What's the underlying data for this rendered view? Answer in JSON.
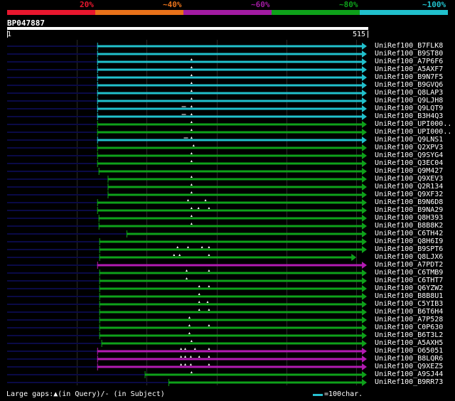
{
  "identity_legend": {
    "labels": [
      "20%",
      "~40%",
      "~60%",
      "~80%",
      "~100%"
    ],
    "colors": [
      "#e8172e",
      "#e8721a",
      "#a21ba2",
      "#0ea11a",
      "#21c0cc"
    ]
  },
  "query": {
    "name": "BP047887",
    "start": "1",
    "end": "515",
    "length": 515
  },
  "colors": {
    "cyan": "#21c0cc",
    "green": "#0ea11a",
    "magenta": "#b21bb2",
    "unaligned": "#0a0a46",
    "grid": "#2a2a2a",
    "gap_marker": "#ffffff"
  },
  "hits": [
    {
      "id": "UniRef100_B7FLK8",
      "color": "cyan",
      "start": 130,
      "end": 515,
      "query_gaps": [],
      "subject_gaps": []
    },
    {
      "id": "UniRef100_B9ST80",
      "color": "cyan",
      "start": 130,
      "end": 515,
      "query_gaps": [],
      "subject_gaps": []
    },
    {
      "id": "UniRef100_A7P6F6",
      "color": "cyan",
      "start": 130,
      "end": 515,
      "query_gaps": [
        265
      ],
      "subject_gaps": []
    },
    {
      "id": "UniRef100_A5AXF7",
      "color": "cyan",
      "start": 130,
      "end": 515,
      "query_gaps": [
        265
      ],
      "subject_gaps": []
    },
    {
      "id": "UniRef100_B9N7F5",
      "color": "cyan",
      "start": 130,
      "end": 515,
      "query_gaps": [
        265
      ],
      "subject_gaps": []
    },
    {
      "id": "UniRef100_B9GVQ6",
      "color": "cyan",
      "start": 130,
      "end": 515,
      "query_gaps": [
        265
      ],
      "subject_gaps": []
    },
    {
      "id": "UniRef100_Q8LAP3",
      "color": "cyan",
      "start": 130,
      "end": 515,
      "query_gaps": [
        265
      ],
      "subject_gaps": []
    },
    {
      "id": "UniRef100_Q9LJH8",
      "color": "cyan",
      "start": 130,
      "end": 515,
      "query_gaps": [
        265
      ],
      "subject_gaps": []
    },
    {
      "id": "UniRef100_Q9LQT9",
      "color": "cyan",
      "start": 130,
      "end": 515,
      "query_gaps": [
        265
      ],
      "subject_gaps": [
        254
      ]
    },
    {
      "id": "UniRef100_B3H4Q3",
      "color": "cyan",
      "start": 130,
      "end": 515,
      "query_gaps": [
        265
      ],
      "subject_gaps": [
        254
      ]
    },
    {
      "id": "UniRef100_UPI000..",
      "color": "green",
      "start": 130,
      "end": 515,
      "query_gaps": [
        265
      ],
      "subject_gaps": []
    },
    {
      "id": "UniRef100_UPI000..",
      "color": "green",
      "start": 130,
      "end": 515,
      "query_gaps": [
        265
      ],
      "subject_gaps": []
    },
    {
      "id": "UniRef100_Q9LNS1",
      "color": "cyan",
      "start": 130,
      "end": 515,
      "query_gaps": [
        265
      ],
      "subject_gaps": [
        257
      ]
    },
    {
      "id": "UniRef100_Q2XPV3",
      "color": "green",
      "start": 130,
      "end": 515,
      "query_gaps": [
        268
      ],
      "subject_gaps": []
    },
    {
      "id": "UniRef100_Q9SYG4",
      "color": "green",
      "start": 130,
      "end": 515,
      "query_gaps": [
        265
      ],
      "subject_gaps": []
    },
    {
      "id": "UniRef100_Q3EC04",
      "color": "green",
      "start": 130,
      "end": 515,
      "query_gaps": [
        265
      ],
      "subject_gaps": []
    },
    {
      "id": "UniRef100_Q9M427",
      "color": "green",
      "start": 132,
      "end": 515,
      "query_gaps": [],
      "subject_gaps": []
    },
    {
      "id": "UniRef100_Q9XEV3",
      "color": "green",
      "start": 145,
      "end": 515,
      "query_gaps": [
        265
      ],
      "subject_gaps": []
    },
    {
      "id": "UniRef100_Q2R134",
      "color": "green",
      "start": 145,
      "end": 515,
      "query_gaps": [
        265
      ],
      "subject_gaps": []
    },
    {
      "id": "UniRef100_Q9XF32",
      "color": "green",
      "start": 145,
      "end": 515,
      "query_gaps": [
        265
      ],
      "subject_gaps": []
    },
    {
      "id": "UniRef100_B9N6D8",
      "color": "green",
      "start": 130,
      "end": 515,
      "query_gaps": [
        260,
        285
      ],
      "subject_gaps": []
    },
    {
      "id": "UniRef100_B9NA29",
      "color": "green",
      "start": 130,
      "end": 515,
      "query_gaps": [
        265,
        275,
        290
      ],
      "subject_gaps": []
    },
    {
      "id": "UniRef100_Q8H393",
      "color": "green",
      "start": 132,
      "end": 515,
      "query_gaps": [
        265
      ],
      "subject_gaps": []
    },
    {
      "id": "UniRef100_B8B8K2",
      "color": "green",
      "start": 132,
      "end": 515,
      "query_gaps": [
        265
      ],
      "subject_gaps": []
    },
    {
      "id": "UniRef100_C6TH42",
      "color": "green",
      "start": 172,
      "end": 515,
      "query_gaps": [],
      "subject_gaps": []
    },
    {
      "id": "UniRef100_Q8H6I9",
      "color": "green",
      "start": 133,
      "end": 515,
      "query_gaps": [],
      "subject_gaps": []
    },
    {
      "id": "UniRef100_B9SPT6",
      "color": "green",
      "start": 133,
      "end": 515,
      "query_gaps": [
        245,
        260,
        280,
        290
      ],
      "subject_gaps": []
    },
    {
      "id": "UniRef100_Q8LJX6",
      "color": "green",
      "start": 133,
      "end": 500,
      "query_gaps": [
        240,
        248,
        290
      ],
      "subject_gaps": []
    },
    {
      "id": "UniRef100_A7PDT2",
      "color": "magenta",
      "start": 130,
      "end": 515,
      "query_gaps": [],
      "subject_gaps": []
    },
    {
      "id": "UniRef100_C6TMB9",
      "color": "green",
      "start": 133,
      "end": 515,
      "query_gaps": [
        258,
        290
      ],
      "subject_gaps": []
    },
    {
      "id": "UniRef100_C6THT7",
      "color": "green",
      "start": 133,
      "end": 515,
      "query_gaps": [
        258
      ],
      "subject_gaps": []
    },
    {
      "id": "UniRef100_Q6YZW2",
      "color": "green",
      "start": 133,
      "end": 515,
      "query_gaps": [
        276,
        290
      ],
      "subject_gaps": []
    },
    {
      "id": "UniRef100_B8B8U1",
      "color": "green",
      "start": 133,
      "end": 515,
      "query_gaps": [
        276
      ],
      "subject_gaps": []
    },
    {
      "id": "UniRef100_C5YIB3",
      "color": "green",
      "start": 133,
      "end": 515,
      "query_gaps": [
        276,
        288
      ],
      "subject_gaps": []
    },
    {
      "id": "UniRef100_B6T6H4",
      "color": "green",
      "start": 133,
      "end": 515,
      "query_gaps": [
        276,
        290
      ],
      "subject_gaps": []
    },
    {
      "id": "UniRef100_A7P528",
      "color": "green",
      "start": 133,
      "end": 515,
      "query_gaps": [
        262
      ],
      "subject_gaps": []
    },
    {
      "id": "UniRef100_C0P630",
      "color": "green",
      "start": 133,
      "end": 515,
      "query_gaps": [
        262,
        290
      ],
      "subject_gaps": []
    },
    {
      "id": "UniRef100_B6T3L2",
      "color": "green",
      "start": 133,
      "end": 515,
      "query_gaps": [
        262
      ],
      "subject_gaps": []
    },
    {
      "id": "UniRef100_A5AXH5",
      "color": "green",
      "start": 136,
      "end": 515,
      "query_gaps": [
        265
      ],
      "subject_gaps": []
    },
    {
      "id": "UniRef100_O65051",
      "color": "magenta",
      "start": 130,
      "end": 515,
      "query_gaps": [
        250,
        256,
        270,
        290
      ],
      "subject_gaps": []
    },
    {
      "id": "UniRef100_B8LQR6",
      "color": "magenta",
      "start": 130,
      "end": 515,
      "query_gaps": [
        250,
        256,
        264,
        276,
        290
      ],
      "subject_gaps": []
    },
    {
      "id": "UniRef100_Q9XEZ5",
      "color": "magenta",
      "start": 130,
      "end": 515,
      "query_gaps": [
        250,
        256,
        264,
        290
      ],
      "subject_gaps": []
    },
    {
      "id": "UniRef100_A9SJ44",
      "color": "green",
      "start": 198,
      "end": 515,
      "query_gaps": [
        265
      ],
      "subject_gaps": []
    },
    {
      "id": "UniRef100_B9RR73",
      "color": "green",
      "start": 232,
      "end": 515,
      "query_gaps": [],
      "subject_gaps": []
    }
  ],
  "footer": {
    "gaps_legend": "Large gaps:▲(in Query)/- (in Subject)",
    "scale_label": "=100char."
  }
}
